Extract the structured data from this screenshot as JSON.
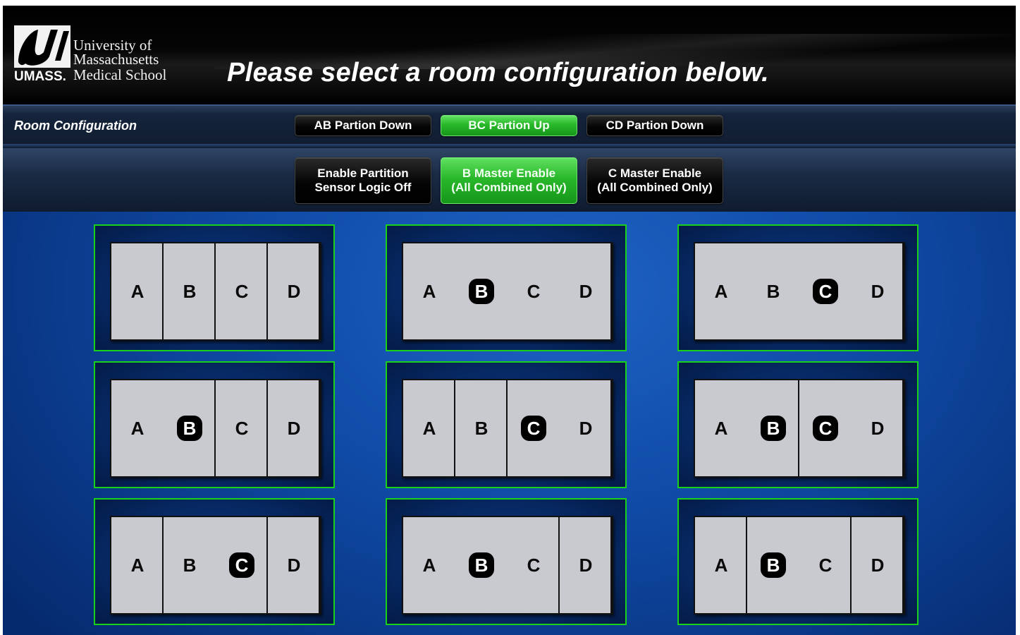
{
  "logo": {
    "line1": "University of",
    "line2": "Massachusetts",
    "line3": "Medical School",
    "umass": "UMASS."
  },
  "header": {
    "title": "Please select a room configuration below."
  },
  "config_bar": {
    "label": "Room Configuration",
    "partition_buttons": [
      {
        "label": "AB Partion Down",
        "active": false
      },
      {
        "label": "BC Partion Up",
        "active": true
      },
      {
        "label": "CD Partion Down",
        "active": false
      }
    ],
    "option_buttons": [
      {
        "line1": "Enable Partition",
        "line2": "Sensor Logic Off",
        "active": false
      },
      {
        "line1": "B Master Enable",
        "line2": "(All Combined Only)",
        "active": true
      },
      {
        "line1": "C Master Enable",
        "line2": "(All Combined Only)",
        "active": false
      }
    ]
  },
  "room_labels": [
    "A",
    "B",
    "C",
    "D"
  ],
  "configurations": [
    {
      "groups": [
        [
          "A"
        ],
        [
          "B"
        ],
        [
          "C"
        ],
        [
          "D"
        ]
      ],
      "master": []
    },
    {
      "groups": [
        [
          "A",
          "B",
          "C",
          "D"
        ]
      ],
      "master": [
        "B"
      ]
    },
    {
      "groups": [
        [
          "A",
          "B",
          "C",
          "D"
        ]
      ],
      "master": [
        "C"
      ]
    },
    {
      "groups": [
        [
          "A",
          "B"
        ],
        [
          "C"
        ],
        [
          "D"
        ]
      ],
      "master": [
        "B"
      ]
    },
    {
      "groups": [
        [
          "A"
        ],
        [
          "B"
        ],
        [
          "C",
          "D"
        ]
      ],
      "master": [
        "C"
      ]
    },
    {
      "groups": [
        [
          "A",
          "B"
        ],
        [
          "C",
          "D"
        ]
      ],
      "master": [
        "B",
        "C"
      ]
    },
    {
      "groups": [
        [
          "A"
        ],
        [
          "B",
          "C"
        ],
        [
          "D"
        ]
      ],
      "master": [
        "C"
      ]
    },
    {
      "groups": [
        [
          "A",
          "B",
          "C"
        ],
        [
          "D"
        ]
      ],
      "master": [
        "B"
      ]
    },
    {
      "groups": [
        [
          "A"
        ],
        [
          "B",
          "C"
        ],
        [
          "D"
        ]
      ],
      "master": [
        "B"
      ]
    }
  ],
  "colors": {
    "active_button": "#29b82a",
    "cell_border": "#19d11b",
    "room_fill": "#c9c9d0",
    "master_badge": "#000000"
  }
}
